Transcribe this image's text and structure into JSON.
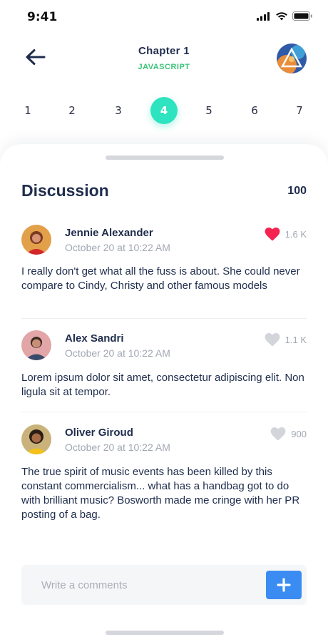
{
  "status": {
    "time": "9:41"
  },
  "header": {
    "title": "Chapter 1",
    "subtitle": "JAVASCRIPT",
    "accent_color": "#3cc37a"
  },
  "chapters": {
    "items": [
      "1",
      "2",
      "3",
      "4",
      "5",
      "6",
      "7"
    ],
    "active": "4",
    "active_color": "#2ee3bf"
  },
  "discussion": {
    "title": "Discussion",
    "count": "100"
  },
  "comments": [
    {
      "name": "Jennie Alexander",
      "date": "October 20 at 10:22 AM",
      "likes": "1.6 K",
      "liked": true,
      "text": "I really don't get what all the fuss is about. She could never compare to Cindy, Christy and other famous models"
    },
    {
      "name": "Alex Sandri",
      "date": "October 20 at 10:22 AM",
      "likes": "1.1 K",
      "liked": false,
      "text": "Lorem ipsum dolor sit amet, consectetur adipiscing elit. Non ligula sit at tempor."
    },
    {
      "name": "Oliver Giroud",
      "date": "October 20 at 10:22 AM",
      "likes": "900",
      "liked": false,
      "text": "The true spirit of music events has been killed by this constant commercialism... what has a handbag got to do with brilliant music? Bosworth made me cringe with her PR posting of a bag."
    }
  ],
  "comment_input": {
    "placeholder": "Write a comments",
    "value": ""
  },
  "colors": {
    "like_active": "#f5234f",
    "like_inactive": "#d3d5da",
    "add_button": "#3a8cf2"
  }
}
